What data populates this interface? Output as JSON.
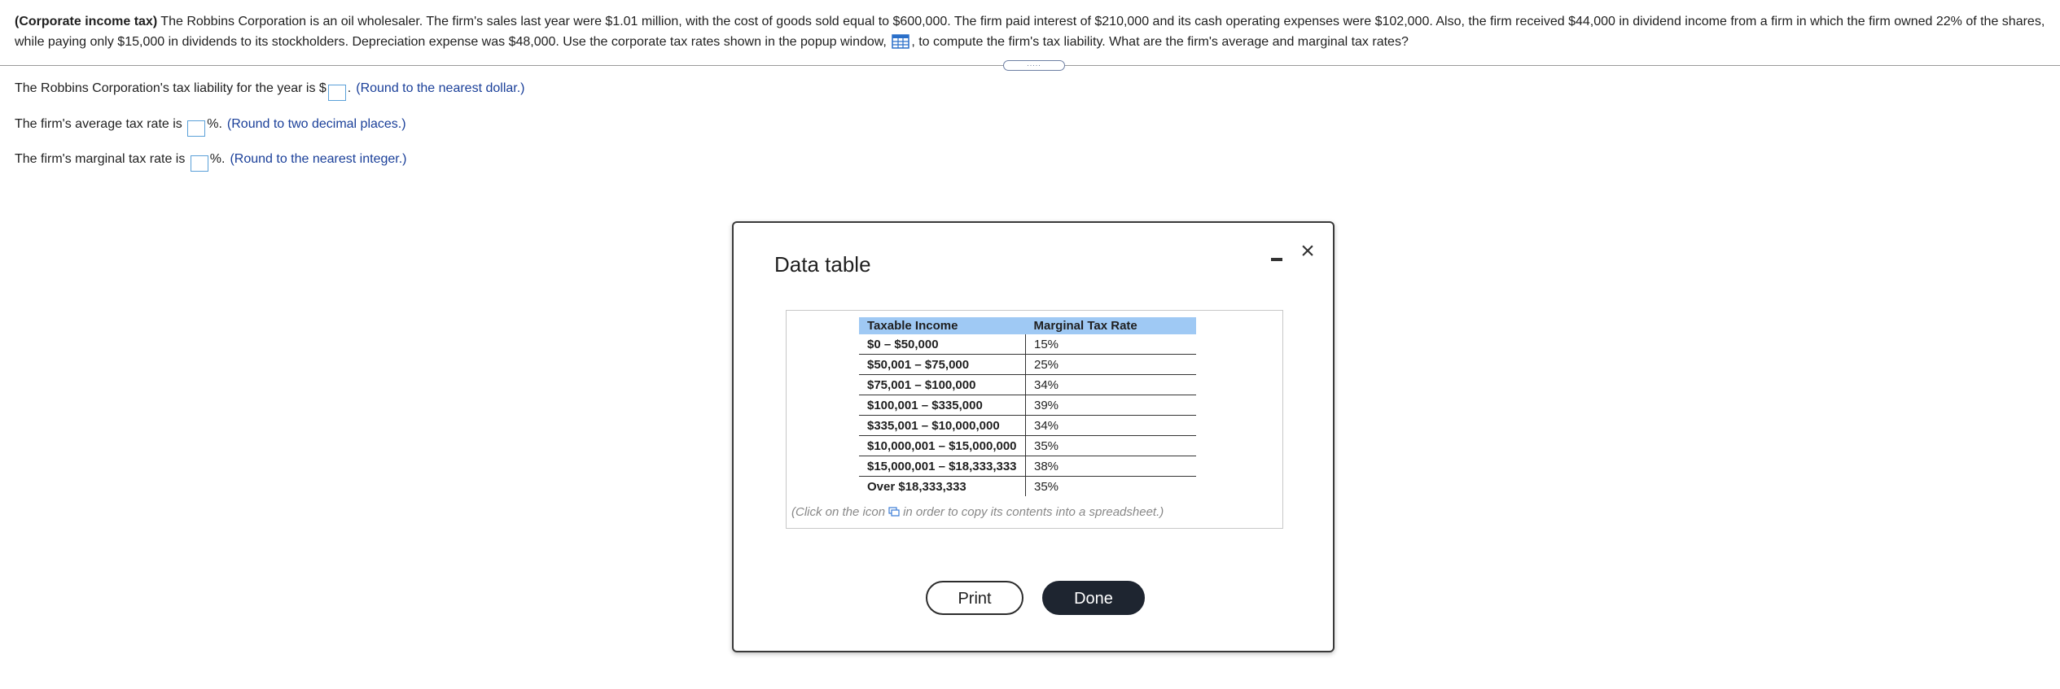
{
  "problem": {
    "lead": "(Corporate income tax)",
    "text_before_icon": " The Robbins Corporation is an oil wholesaler.  The firm's sales last year were $1.01 million, with the cost of goods sold equal to $600,000.  The firm paid interest of $210,000 and its cash operating expenses were $102,000.  Also, the firm received $44,000 in dividend income from a firm in which the firm owned 22% of the shares, while paying only $15,000 in dividends to its stockholders.  Depreciation expense was $48,000.  Use the corporate tax rates shown in the popup window, ",
    "text_after_icon": ", to compute the firm's tax liability.  What are the firm's average and marginal tax rates?",
    "icon": "table-icon"
  },
  "questions": [
    {
      "prefix": "The Robbins Corporation's tax liability for the year is $",
      "suffix": ".",
      "hint": "(Round to the nearest dollar.)"
    },
    {
      "prefix": "The firm's average tax rate is ",
      "suffix": "%.",
      "hint": "(Round to two decimal places.)"
    },
    {
      "prefix": "The firm's marginal tax rate is ",
      "suffix": "%.",
      "hint": "(Round to the nearest integer.)"
    }
  ],
  "divider": {
    "handle": "....."
  },
  "modal": {
    "title": "Data table",
    "close": "×",
    "headers": [
      "Taxable Income",
      "Marginal Tax Rate"
    ],
    "rows": [
      [
        "$0 – $50,000",
        "15%"
      ],
      [
        "$50,001 – $75,000",
        "25%"
      ],
      [
        "$75,001 – $100,000",
        "34%"
      ],
      [
        "$100,001 – $335,000",
        "39%"
      ],
      [
        "$335,001 – $10,000,000",
        "34%"
      ],
      [
        "$10,000,001 – $15,000,000",
        "35%"
      ],
      [
        "$15,000,001 – $18,333,333",
        "38%"
      ],
      [
        "Over $18,333,333",
        "35%"
      ]
    ],
    "copy_note_before": "(Click on the icon",
    "copy_note_after": "in order to copy its contents into a spreadsheet.)",
    "print_label": "Print",
    "done_label": "Done"
  },
  "colors": {
    "header_bg": "#9fc9f4",
    "hint": "#1a3f99",
    "done_bg": "#1e2530",
    "input_border": "#5aa0d8"
  }
}
